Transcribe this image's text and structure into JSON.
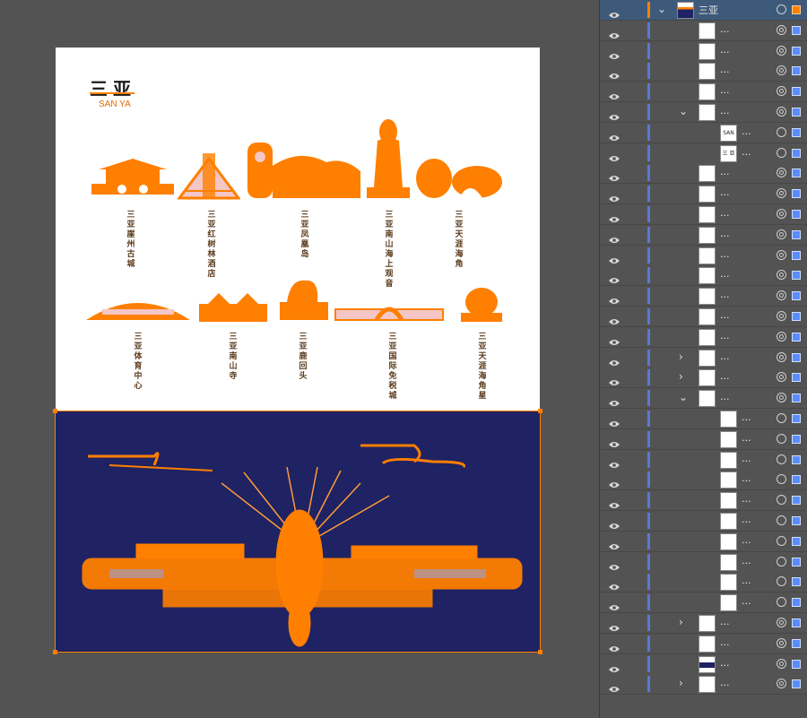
{
  "artboard": {
    "title_cn": "三亚",
    "title_en": "SAN YA",
    "landmarks_row1": [
      {
        "label": "三亚崖州古城"
      },
      {
        "label": "三亚红树林酒店"
      },
      {
        "label": "三亚凤凰岛"
      },
      {
        "label": "三亚南山海上观音"
      },
      {
        "label": "三亚天涯海角"
      }
    ],
    "landmarks_row2": [
      {
        "label": "三亚体育中心"
      },
      {
        "label": "三亚南山寺"
      },
      {
        "label": "三亚鹿回头"
      },
      {
        "label": "三亚国际免税城"
      },
      {
        "label": "三亚天涯海角星"
      }
    ]
  },
  "colors": {
    "accent": "#ff7f00",
    "dark_panel": "#1f2263",
    "selection": "#5b8cff"
  },
  "layers": {
    "top_layer_name": "三亚",
    "ellipsis": "...",
    "sub_thumb_labels": [
      "SAN YA",
      "三 亚"
    ],
    "icons": {
      "visibility": "eye-icon",
      "expand": "chevron-icon",
      "target": "target-icon"
    }
  }
}
